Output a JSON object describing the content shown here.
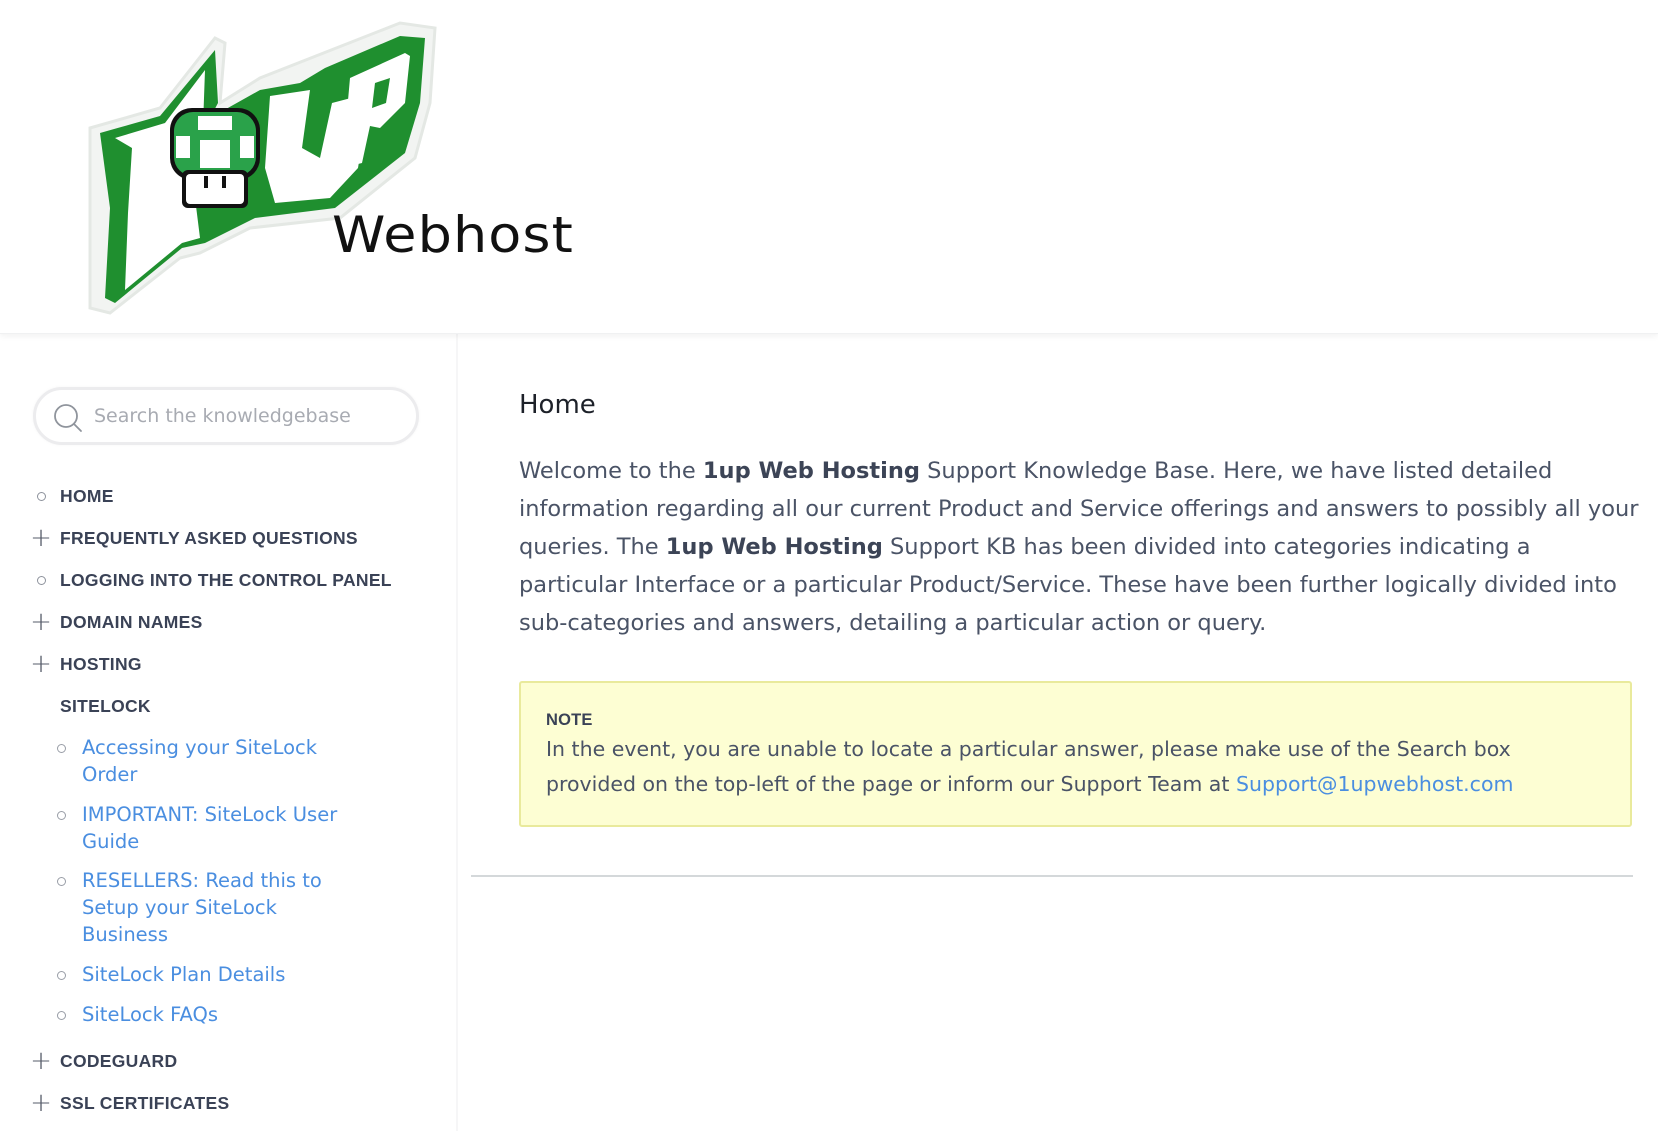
{
  "header": {
    "logo": {
      "name": "1up Webhost",
      "mark_text": "1UP",
      "wordmark": "Webhost",
      "colors": {
        "green": "#1f8f2f",
        "dark_green": "#0d6e1f",
        "mushroom_green": "#2aa24a"
      }
    }
  },
  "sidebar": {
    "search": {
      "placeholder": "Search the knowledgebase",
      "value": ""
    },
    "items": [
      {
        "label": "HOME",
        "icon": "circle-bullet-icon",
        "expandable": false
      },
      {
        "label": "FREQUENTLY ASKED QUESTIONS",
        "icon": "plus-icon",
        "expandable": true
      },
      {
        "label": "LOGGING INTO THE CONTROL PANEL",
        "icon": "circle-bullet-icon",
        "expandable": false
      },
      {
        "label": "DOMAIN NAMES",
        "icon": "plus-icon",
        "expandable": true
      },
      {
        "label": "HOSTING",
        "icon": "plus-icon",
        "expandable": true
      },
      {
        "label": "SITELOCK",
        "icon": "",
        "expandable": false,
        "expanded": true
      },
      {
        "label": "CODEGUARD",
        "icon": "plus-icon",
        "expandable": true
      },
      {
        "label": "SSL CERTIFICATES",
        "icon": "plus-icon",
        "expandable": true
      }
    ],
    "sitelock_children": [
      {
        "label": "Accessing your SiteLock Order"
      },
      {
        "label": "IMPORTANT: SiteLock User Guide"
      },
      {
        "label": "RESELLERS: Read this to Setup your SiteLock Business"
      },
      {
        "label": "SiteLock Plan Details"
      },
      {
        "label": "SiteLock FAQs"
      }
    ]
  },
  "main": {
    "title": "Home",
    "intro": {
      "p1": "Welcome to the ",
      "b1": "1up Web Hosting",
      "p2": " Support Knowledge Base. Here, we have listed detailed information regarding all our current Product and Service offerings and answers to possibly all your queries. The ",
      "b2": "1up Web Hosting",
      "p3": " Support KB has been divided into categories indicating a particular Interface or a particular Product/Service. These have been further logically divided into sub-categories and answers, detailing a particular action or query."
    },
    "note": {
      "label": "NOTE",
      "text": "In the event, you are unable to locate a particular answer, please make use of the Search box provided on the top-left of the page or inform our Support Team at ",
      "email": "Support@1upwebhost.com"
    }
  },
  "colors": {
    "link": "#4a8ee0",
    "text": "#4a5366",
    "nav_text": "#3a4256",
    "note_bg": "#fdfed3",
    "note_border": "#e9ea9c"
  }
}
